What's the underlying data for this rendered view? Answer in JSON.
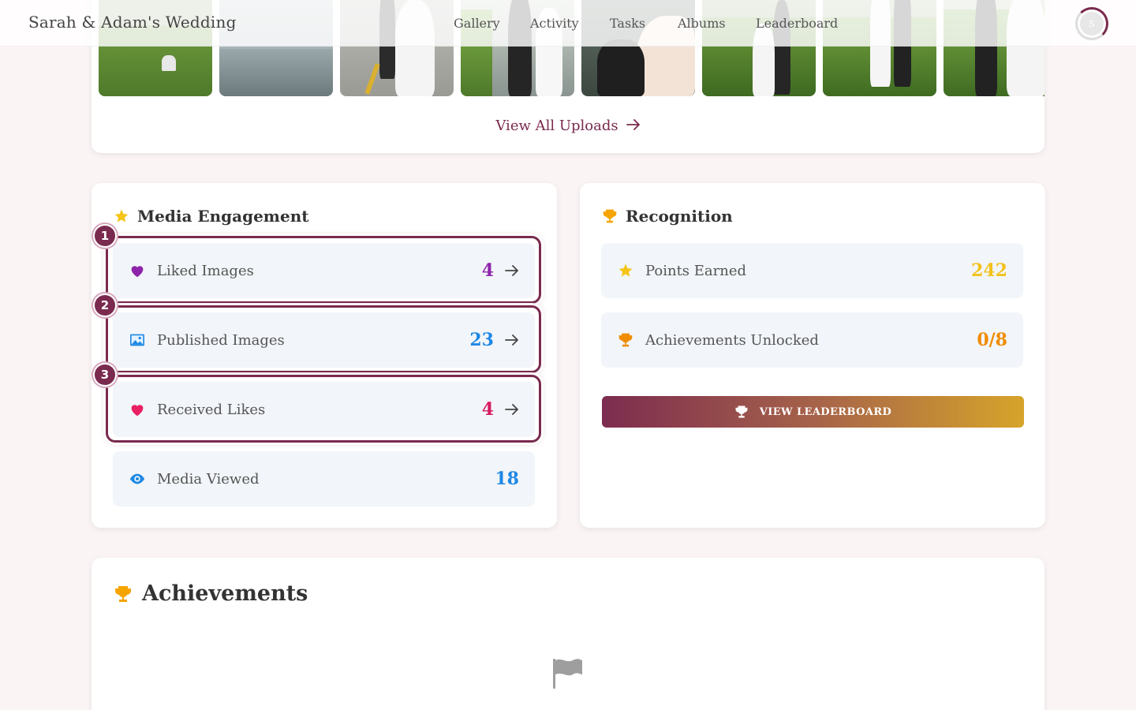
{
  "header": {
    "brand": "Sarah & Adam's Wedding",
    "nav": [
      "Gallery",
      "Activity",
      "Tasks",
      "Albums",
      "Leaderboard"
    ],
    "avatar_initial": "S"
  },
  "gallery": {
    "view_all_label": "View All Uploads"
  },
  "media_engagement": {
    "title": "Media Engagement",
    "items": [
      {
        "label": "Liked Images",
        "value": "4",
        "icon": "heart-purple-icon",
        "color": "#8e24aa",
        "badge": "1"
      },
      {
        "label": "Published Images",
        "value": "23",
        "icon": "image-icon",
        "color": "#1e88e5",
        "badge": "2"
      },
      {
        "label": "Received Likes",
        "value": "4",
        "icon": "heart-pink-icon",
        "color": "#d81b60",
        "badge": "3"
      },
      {
        "label": "Media Viewed",
        "value": "18",
        "icon": "eye-icon",
        "color": "#1e88e5"
      }
    ]
  },
  "recognition": {
    "title": "Recognition",
    "items": [
      {
        "label": "Points Earned",
        "value": "242",
        "icon": "star-icon",
        "color": "#f5c518"
      },
      {
        "label": "Achievements Unlocked",
        "value": "0/8",
        "icon": "trophy-icon",
        "color": "#f08c00"
      }
    ],
    "leaderboard_button": "VIEW LEADERBOARD"
  },
  "achievements": {
    "title": "Achievements"
  },
  "colors": {
    "accent": "#7a2a4e",
    "gold": "#d6a42a",
    "background": "#fbf4f5"
  }
}
